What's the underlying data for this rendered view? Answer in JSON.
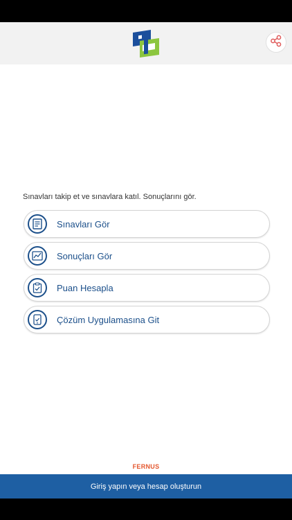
{
  "header": {
    "logo_icon": "app-logo",
    "share_icon": "share-icon",
    "logo_colors": [
      "#1b4f9c",
      "#8cc63f",
      "#ffffff"
    ],
    "share_color": "#e05a5a"
  },
  "intro_text": "Sınavları takip et ve sınavlara katıl. Sonuçlarını gör.",
  "menu": {
    "items": [
      {
        "label": "Sınavları Gör",
        "icon": "exam-list-icon"
      },
      {
        "label": "Sonuçları Gör",
        "icon": "results-chart-icon"
      },
      {
        "label": "Puan Hesapla",
        "icon": "score-clipboard-icon"
      },
      {
        "label": "Çözüm Uygulamasına Git",
        "icon": "solution-app-icon"
      }
    ]
  },
  "brand": "FERNUS",
  "login_bar": {
    "label": "Giriş yapın veya hesap oluşturun"
  },
  "colors": {
    "primary": "#1b4f8a",
    "login_bar": "#1e5fa3",
    "brand": "#e4572e",
    "header_bg": "#f2f2f2"
  }
}
